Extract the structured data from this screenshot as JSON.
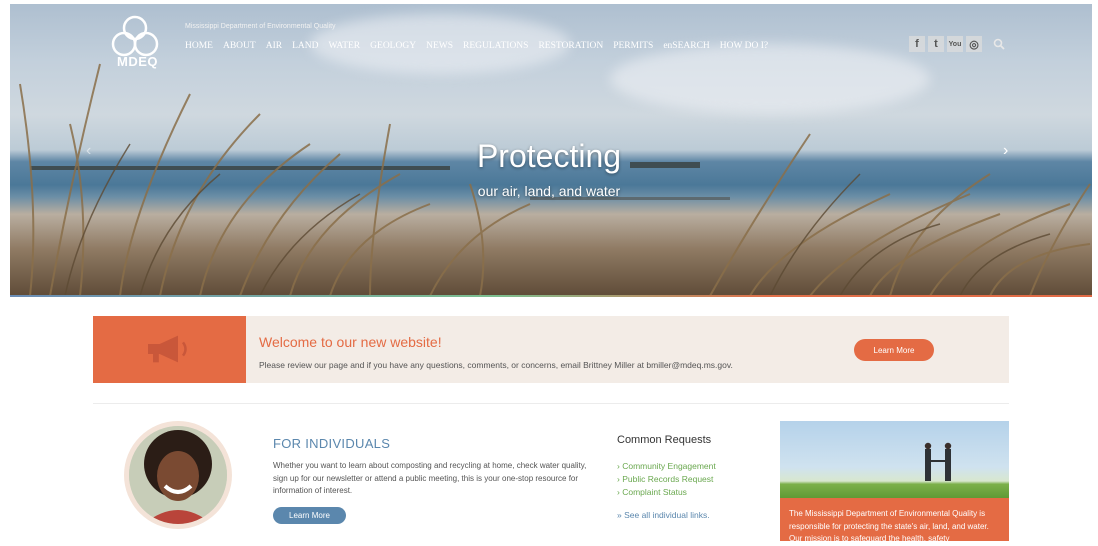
{
  "header": {
    "logo_text": "MDEQ",
    "agency_name": "Mississippi Department of Environmental Quality",
    "nav": [
      "HOME",
      "ABOUT",
      "AIR",
      "LAND",
      "WATER",
      "GEOLOGY",
      "NEWS",
      "REGULATIONS",
      "RESTORATION",
      "PERMITS",
      "enSEARCH",
      "HOW DO I?"
    ],
    "social_icons": [
      "facebook-icon",
      "twitter-icon",
      "youtube-icon",
      "instagram-icon"
    ],
    "social_glyphs": [
      "f",
      "t",
      "You",
      "◎"
    ]
  },
  "hero": {
    "title": "Protecting",
    "subtitle": "our air, land, and water"
  },
  "announcement": {
    "title": "Welcome to our new website!",
    "text": "Please review our page and if you have any questions, comments, or concerns, email Brittney Miller at bmiller@mdeq.ms.gov.",
    "button": "Learn More"
  },
  "individuals": {
    "title": "FOR INDIVIDUALS",
    "text": "Whether you want to learn about composting and recycling at home, check water quality, sign up for our newsletter or attend a public meeting, this is your one-stop resource for information of interest.",
    "button": "Learn More"
  },
  "common_requests": {
    "title": "Common Requests",
    "items": [
      "Community Engagement",
      "Public Records Request",
      "Complaint Status"
    ],
    "see_all": "» See all individual links."
  },
  "about_card": {
    "text": "The Mississippi Department of Environmental Quality is responsible for protecting the state's air, land, and water. Our mission is to safeguard the health, safety"
  },
  "colors": {
    "accent_orange": "#e46b44",
    "accent_blue": "#5b87ad",
    "link_green": "#6aa84f",
    "announce_bg": "#f3ece6"
  }
}
